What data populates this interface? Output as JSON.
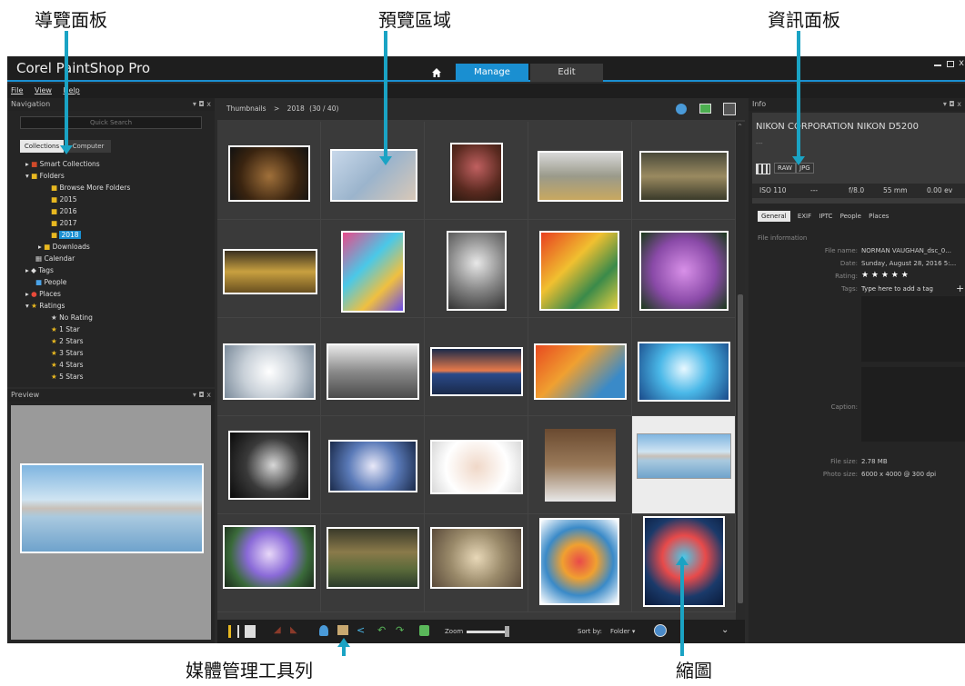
{
  "callouts": {
    "nav_panel": "導覽面板",
    "preview_area": "預覽區域",
    "info_panel": "資訊面板",
    "toolbar": "媒體管理工具列",
    "thumbnail": "縮圖"
  },
  "app": {
    "title": "Corel PaintShop Pro",
    "tabs": {
      "manage": "Manage",
      "edit": "Edit"
    },
    "menu": {
      "file": "File",
      "view": "View",
      "help": "Help"
    },
    "window_controls": [
      "—",
      "□",
      "x"
    ]
  },
  "navigation": {
    "title": "Navigation",
    "controls": "▾ ◘ x",
    "search_placeholder": "Quick Search",
    "tab_collections": "Collections",
    "tab_computer": "Computer",
    "tree": {
      "smart_collections": "Smart Collections",
      "folders": "Folders",
      "browse": "Browse More Folders",
      "y2015": "2015",
      "y2016": "2016",
      "y2017": "2017",
      "y2018": "2018",
      "downloads": "Downloads",
      "calendar": "Calendar",
      "tags": "Tags",
      "people": "People",
      "places": "Places",
      "ratings": "Ratings",
      "no_rating": "No Rating",
      "star1": "1 Star",
      "star2": "2 Stars",
      "star3": "3 Stars",
      "star4": "4 Stars",
      "star5": "5 Stars"
    }
  },
  "preview": {
    "title": "Preview",
    "controls": "▾ ◘ x"
  },
  "thumbnails": {
    "breadcrumb_root": "Thumbnails",
    "breadcrumb_sep": ">",
    "breadcrumb_folder": "2018",
    "breadcrumb_count": "(30 / 40)"
  },
  "toolbar": {
    "zoom_label": "Zoom",
    "sort_label": "Sort by:",
    "sort_value": "Folder"
  },
  "info": {
    "title": "Info",
    "controls": "▾ ◘ x",
    "camera": "NIKON CORPORATION NIKON D5200",
    "camera_sub": "---",
    "format": "JPG",
    "raw_label": "RAW",
    "iso": "ISO 110",
    "dash": "---",
    "aperture": "f/8.0",
    "focal": "55 mm",
    "ev": "0.00 ev",
    "tabs": {
      "general": "General",
      "exif": "EXIF",
      "iptc": "IPTC",
      "people": "People",
      "places": "Places"
    },
    "section": "File information",
    "labels": {
      "file_name": "File name:",
      "date": "Date:",
      "rating": "Rating:",
      "tags": "Tags:",
      "caption": "Caption:",
      "file_size": "File size:",
      "photo_size": "Photo size:"
    },
    "values": {
      "file_name": "NORMAN VAUGHAN_dsc_0...",
      "date": "Sunday, August 28, 2016 5:...",
      "rating": "★ ★ ★ ★ ★",
      "tags": "Type here to add a tag",
      "file_size": "2.78 MB",
      "photo_size": "6000 x 4000 @ 300 dpi"
    },
    "add_tag": "+"
  },
  "colors": {
    "accent": "#1aa3c4",
    "selection": "#1a8fd1",
    "folder": "#e8b820",
    "star": "#e8b820"
  }
}
